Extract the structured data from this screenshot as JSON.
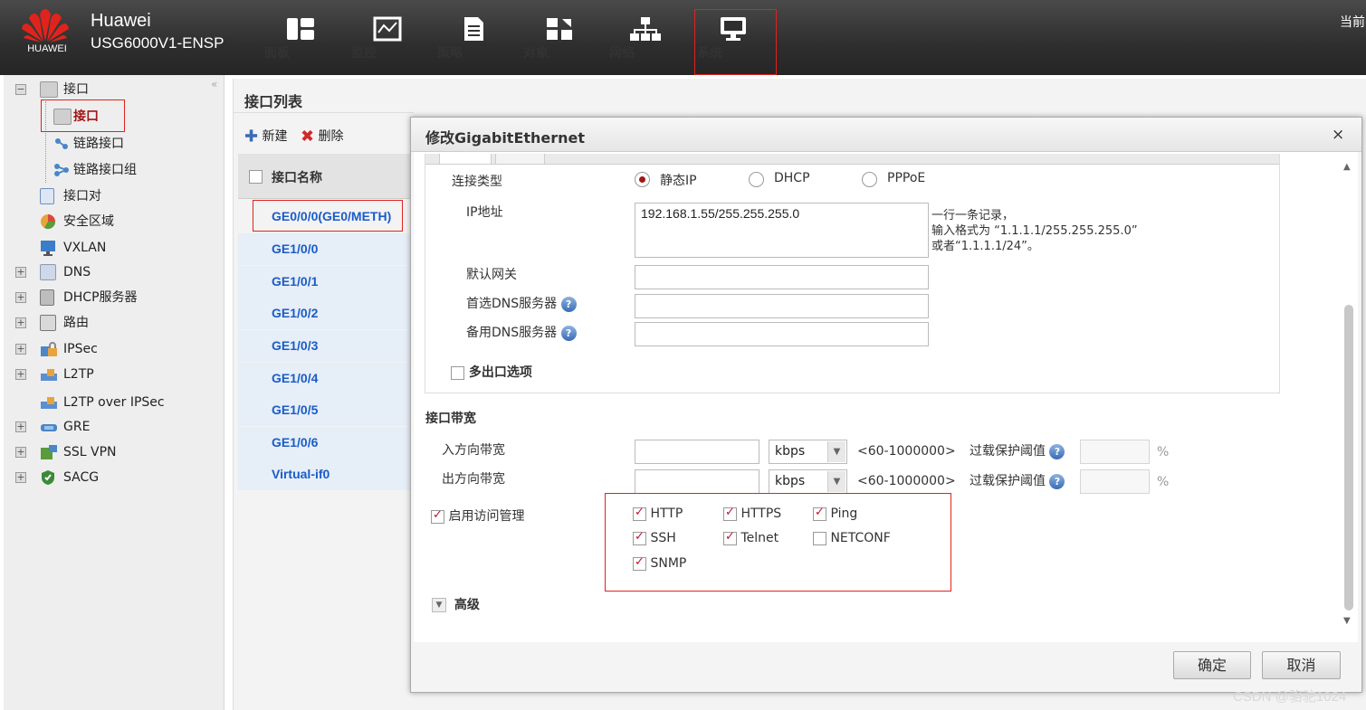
{
  "header": {
    "logo_text": "HUAWEI",
    "brand": "Huawei",
    "model": "USG6000V1-ENSP",
    "current_user": "当前",
    "nav": [
      {
        "label": "面板",
        "icon": "dashboard-icon"
      },
      {
        "label": "监控",
        "icon": "monitor-icon"
      },
      {
        "label": "策略",
        "icon": "policy-icon"
      },
      {
        "label": "对象",
        "icon": "object-icon"
      },
      {
        "label": "网络",
        "icon": "network-icon"
      },
      {
        "label": "系统",
        "icon": "system-icon"
      }
    ]
  },
  "tree": {
    "collapse_glyph": "«",
    "items": [
      {
        "label": "接口",
        "expander": "−"
      },
      {
        "label": "接口"
      },
      {
        "label": "链路接口"
      },
      {
        "label": "链路接口组"
      },
      {
        "label": "接口对"
      },
      {
        "label": "安全区域"
      },
      {
        "label": "VXLAN"
      },
      {
        "label": "DNS",
        "expander": "+"
      },
      {
        "label": "DHCP服务器",
        "expander": "+"
      },
      {
        "label": "路由",
        "expander": "+"
      },
      {
        "label": "IPSec",
        "expander": "+"
      },
      {
        "label": "L2TP",
        "expander": "+"
      },
      {
        "label": "L2TP over IPSec"
      },
      {
        "label": "GRE",
        "expander": "+"
      },
      {
        "label": "SSL VPN",
        "expander": "+"
      },
      {
        "label": "SACG",
        "expander": "+"
      }
    ]
  },
  "list": {
    "title": "接口列表",
    "new_label": "新建",
    "delete_label": "删除",
    "column_header": "接口名称",
    "rows": [
      "GE0/0/0(GE0/METH)",
      "GE1/0/0",
      "GE1/0/1",
      "GE1/0/2",
      "GE1/0/3",
      "GE1/0/4",
      "GE1/0/5",
      "GE1/0/6",
      "Virtual-if0"
    ]
  },
  "dialog": {
    "title": "修改GigabitEthernet",
    "close_glyph": "×",
    "connection_type_label": "连接类型",
    "connection_options": [
      "静态IP",
      "DHCP",
      "PPPoE"
    ],
    "connection_selected": "静态IP",
    "ip_label": "IP地址",
    "ip_value": "192.168.1.55/255.255.255.0",
    "ip_hint": [
      "一行一条记录，",
      "输入格式为 “1.1.1.1/255.255.255.0”",
      "或者“1.1.1.1/24”。"
    ],
    "gateway_label": "默认网关",
    "gateway_value": "",
    "dns1_label": "首选DNS服务器",
    "dns1_value": "",
    "dns2_label": "备用DNS服务器",
    "dns2_value": "",
    "multi_exit_label": "多出口选项",
    "multi_exit_checked": false,
    "bandwidth_section": "接口带宽",
    "inbound_label": "入方向带宽",
    "outbound_label": "出方向带宽",
    "unit": "kbps",
    "range": "<60-1000000>",
    "threshold_label": "过载保护阈值",
    "percent": "%",
    "access_mgmt_label": "启用访问管理",
    "access_mgmt_checked": true,
    "services": [
      {
        "label": "HTTP",
        "checked": true
      },
      {
        "label": "HTTPS",
        "checked": true
      },
      {
        "label": "Ping",
        "checked": true
      },
      {
        "label": "SSH",
        "checked": true
      },
      {
        "label": "Telnet",
        "checked": true
      },
      {
        "label": "NETCONF",
        "checked": false
      },
      {
        "label": "SNMP",
        "checked": true
      }
    ],
    "advanced_label": "高级",
    "ok_label": "确定",
    "cancel_label": "取消"
  },
  "watermark": "CSDN @骆驼1024",
  "colors": {
    "highlight_red": "#e0231c",
    "link_blue": "#1a5cc8",
    "header_bg": "#2e2e2e"
  }
}
